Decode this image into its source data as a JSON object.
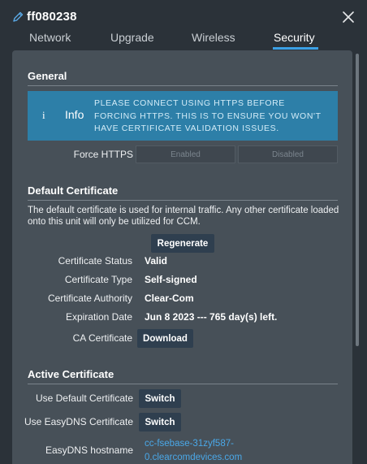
{
  "header": {
    "title": "ff080238",
    "icon": "pencil-icon",
    "close_icon": "close-icon"
  },
  "tabs": [
    {
      "label": "Network"
    },
    {
      "label": "Upgrade"
    },
    {
      "label": "Wireless"
    },
    {
      "label": "Security",
      "active": true
    }
  ],
  "general": {
    "title": "General",
    "info": {
      "icon_glyph": "i",
      "label": "Info",
      "message": "PLEASE CONNECT USING HTTPS BEFORE FORCING HTTPS. THIS IS TO ENSURE YOU WON'T HAVE CERTIFICATE VALIDATION ISSUES."
    },
    "force_https": {
      "label": "Force HTTPS",
      "options": [
        "Enabled",
        "Disabled"
      ]
    }
  },
  "default_certificate": {
    "title": "Default Certificate",
    "description": "The default certificate is used for internal traffic. Any other certificate loaded onto this unit will only be utilized for CCM.",
    "regenerate_label": "Regenerate",
    "status_label": "Certificate Status",
    "status_value": "Valid",
    "type_label": "Certificate Type",
    "type_value": "Self-signed",
    "authority_label": "Certificate Authority",
    "authority_value": "Clear-Com",
    "expiration_label": "Expiration Date",
    "expiration_value": "Jun 8 2023 --- 765 day(s) left.",
    "ca_label": "CA Certificate",
    "download_label": "Download"
  },
  "active_certificate": {
    "title": "Active Certificate",
    "use_default_label": "Use Default Certificate",
    "use_easydns_label": "Use EasyDNS Certificate",
    "switch_label": "Switch",
    "hostname_label": "EasyDNS hostname",
    "hostname_line1": "cc-fsebase-31zyf587-",
    "hostname_line2": "0.clearcomdevices.com"
  },
  "colors": {
    "background": "#2b3239",
    "panel": "#475058",
    "info_box": "#2d7fa8",
    "accent": "#3ba0e6",
    "button": "#2f3f4f",
    "link": "#4aa8e8"
  }
}
